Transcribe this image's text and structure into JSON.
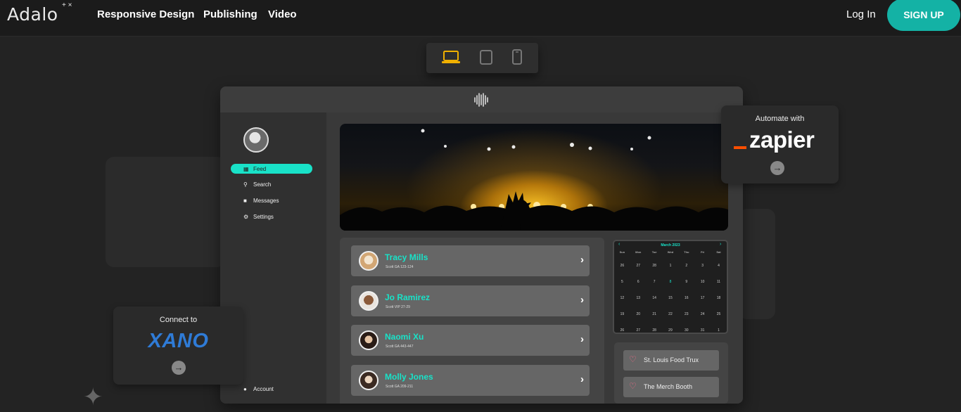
{
  "brand": {
    "name": "Adalo",
    "stars": "+ ×"
  },
  "nav": {
    "links": [
      "Responsive Design",
      "Publishing",
      "Video"
    ],
    "login": "Log In",
    "signup": "SIGN UP"
  },
  "switcher": {
    "devices": [
      "laptop-icon",
      "tablet-icon",
      "phone-icon"
    ],
    "active": "laptop-icon",
    "active_color": "#f0b000"
  },
  "app": {
    "sidebar": {
      "items": [
        {
          "label": "Feed",
          "icon": "grid-icon"
        },
        {
          "label": "Search",
          "icon": "search-icon"
        },
        {
          "label": "Messages",
          "icon": "chat-icon"
        },
        {
          "label": "Settings",
          "icon": "gear-icon"
        }
      ],
      "account": "Account"
    },
    "people": [
      {
        "name": "Tracy Mills",
        "sub": "Scott GA 123-124"
      },
      {
        "name": "Jo Ramirez",
        "sub": "Scott VIP 27-29"
      },
      {
        "name": "Naomi Xu",
        "sub": "Scott GA 443-447"
      },
      {
        "name": "Molly Jones",
        "sub": "Scott GA 209-211"
      }
    ],
    "calendar": {
      "title": "March 2023",
      "dow": [
        "Sun",
        "Mon",
        "Tue",
        "Wed",
        "Thu",
        "Fri",
        "Sat"
      ],
      "weeks": [
        [
          "26",
          "27",
          "28",
          "1",
          "2",
          "3",
          "4"
        ],
        [
          "5",
          "6",
          "7",
          "8",
          "9",
          "10",
          "11"
        ],
        [
          "12",
          "13",
          "14",
          "15",
          "16",
          "17",
          "18"
        ],
        [
          "19",
          "20",
          "21",
          "22",
          "23",
          "24",
          "25"
        ],
        [
          "26",
          "27",
          "28",
          "29",
          "30",
          "31",
          "1"
        ]
      ]
    },
    "venues": [
      "St. Louis Food Trux",
      "The Merch Booth"
    ]
  },
  "zapier": {
    "heading": "Automate with",
    "logo": "zapier"
  },
  "xano": {
    "heading": "Connect to",
    "logo": "XANO"
  },
  "colors": {
    "accent": "#14b2a5",
    "teal_text": "#19e2c8",
    "zapier_orange": "#ff4f00",
    "xano_blue": "#2f7bd6"
  }
}
